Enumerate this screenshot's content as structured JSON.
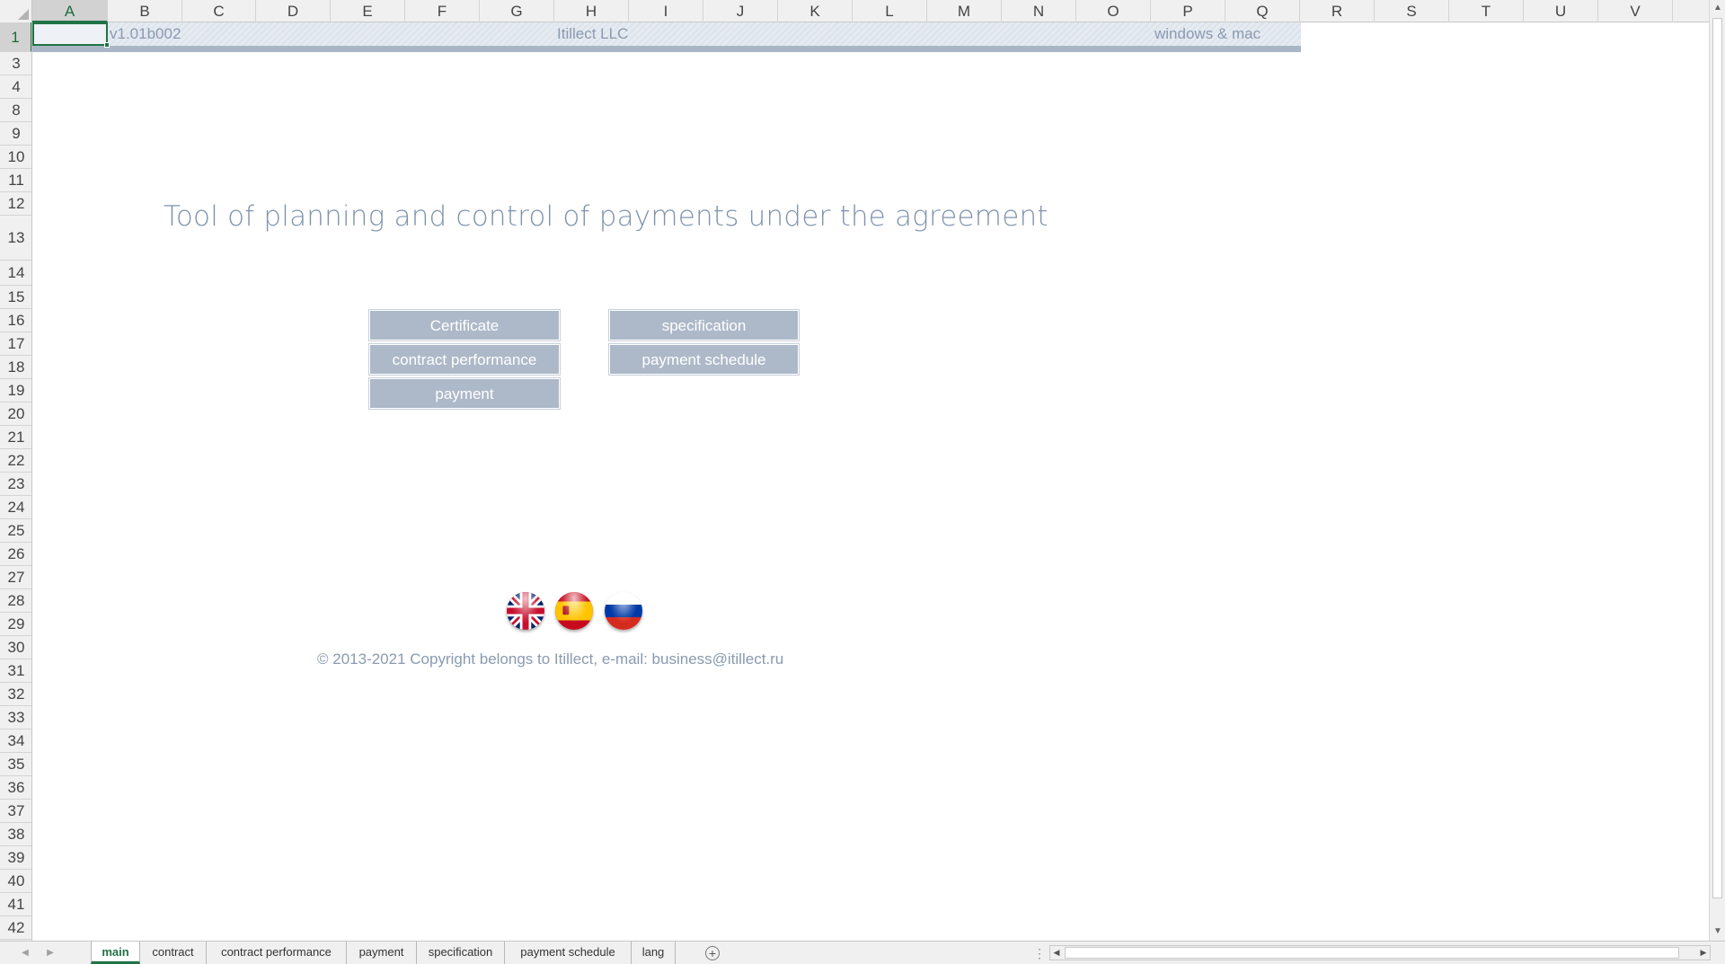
{
  "spreadsheet": {
    "columns": [
      "A",
      "B",
      "C",
      "D",
      "E",
      "F",
      "G",
      "H",
      "I",
      "J",
      "K",
      "L",
      "M",
      "N",
      "O",
      "P",
      "Q",
      "R",
      "S",
      "T",
      "U",
      "V"
    ],
    "active_column": "A",
    "rows": [
      "1",
      "3",
      "4",
      "8",
      "9",
      "10",
      "11",
      "12",
      "13",
      "14",
      "15",
      "16",
      "17",
      "18",
      "19",
      "20",
      "21",
      "22",
      "23",
      "24",
      "25",
      "26",
      "27",
      "28",
      "29",
      "30",
      "31",
      "32",
      "33",
      "34",
      "35",
      "36",
      "37",
      "38",
      "39",
      "40",
      "41",
      "42"
    ],
    "active_row": "1"
  },
  "header_band": {
    "version": "v1.01b002",
    "company": "Itillect LLC",
    "platform": "windows & mac"
  },
  "main": {
    "title": "Tool of planning and control of payments under the agreement",
    "buttons": {
      "certificate": "Certificate",
      "contract_performance": "contract performance",
      "payment": "payment",
      "specification": "specification",
      "payment_schedule": "payment schedule"
    },
    "flags": [
      "uk-flag-icon",
      "spain-flag-icon",
      "russia-flag-icon"
    ],
    "copyright": "© 2013-2021 Copyright belongs to  Itillect, e-mail: business@itillect.ru"
  },
  "sheet_tabs": [
    "main",
    "contract",
    "contract performance",
    "payment",
    "specification",
    "payment schedule",
    "lang"
  ],
  "active_sheet": "main",
  "colors": {
    "accent": "#217346",
    "button_bg": "#adb9c9",
    "title_text": "#7f93ac"
  }
}
